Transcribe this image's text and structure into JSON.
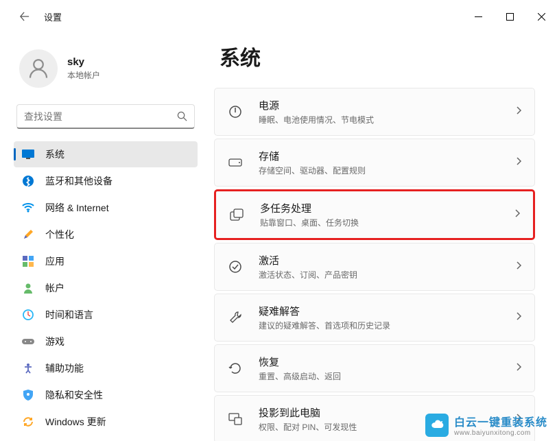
{
  "window": {
    "title": "设置"
  },
  "profile": {
    "name": "sky",
    "subtitle": "本地帐户"
  },
  "search": {
    "placeholder": "查找设置"
  },
  "nav": {
    "items": [
      {
        "label": "系统"
      },
      {
        "label": "蓝牙和其他设备"
      },
      {
        "label": "网络 & Internet"
      },
      {
        "label": "个性化"
      },
      {
        "label": "应用"
      },
      {
        "label": "帐户"
      },
      {
        "label": "时间和语言"
      },
      {
        "label": "游戏"
      },
      {
        "label": "辅助功能"
      },
      {
        "label": "隐私和安全性"
      },
      {
        "label": "Windows 更新"
      }
    ]
  },
  "page": {
    "title": "系统"
  },
  "cards": [
    {
      "title": "电源",
      "desc": "睡眠、电池使用情况、节电模式"
    },
    {
      "title": "存储",
      "desc": "存储空间、驱动器、配置规则"
    },
    {
      "title": "多任务处理",
      "desc": "贴靠窗口、桌面、任务切换"
    },
    {
      "title": "激活",
      "desc": "激活状态、订阅、产品密钥"
    },
    {
      "title": "疑难解答",
      "desc": "建议的疑难解答、首选项和历史记录"
    },
    {
      "title": "恢复",
      "desc": "重置、高级启动、返回"
    },
    {
      "title": "投影到此电脑",
      "desc": "权限、配对 PIN、可发现性"
    }
  ],
  "watermark": {
    "title": "白云一键重装系统",
    "url": "www.baiyunxitong.com"
  }
}
